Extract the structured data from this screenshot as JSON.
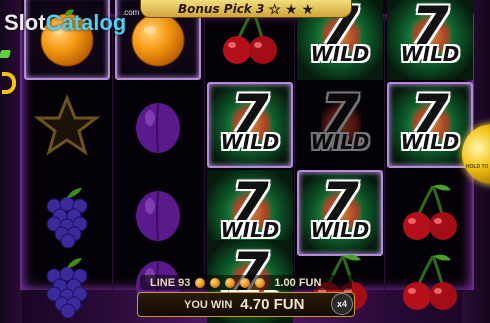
{
  "watermark": {
    "brand_main": "Slot",
    "brand_accent": "Catalog",
    "tld": ".com"
  },
  "bonus": {
    "label": "Bonus Pick 3",
    "stars": [
      "☆",
      "★",
      "★"
    ]
  },
  "reels": [
    [
      "orange",
      "star",
      "grapes",
      "grapes"
    ],
    [
      "orange",
      "plum",
      "plum",
      "plum"
    ],
    [
      "cherry",
      "wild",
      "wild",
      "wild"
    ],
    [
      "wild",
      "wild",
      "wild",
      "cherry"
    ],
    [
      "wild",
      "wild",
      "cherry",
      "cherry"
    ]
  ],
  "line_info": {
    "label": "LINE 93",
    "coins": 5,
    "amount": "1.00 FUN"
  },
  "win": {
    "label": "YOU WIN",
    "value": "4.70 FUN",
    "multiplier": "x4"
  },
  "wild_symbol": {
    "number": "7",
    "word": "WILD"
  },
  "hold_button": {
    "text": "HOLD TO"
  },
  "colors": {
    "win_border": "#b58ad8",
    "wild_glow": "#2cc35e",
    "banner_gold": "#e7c25a"
  }
}
